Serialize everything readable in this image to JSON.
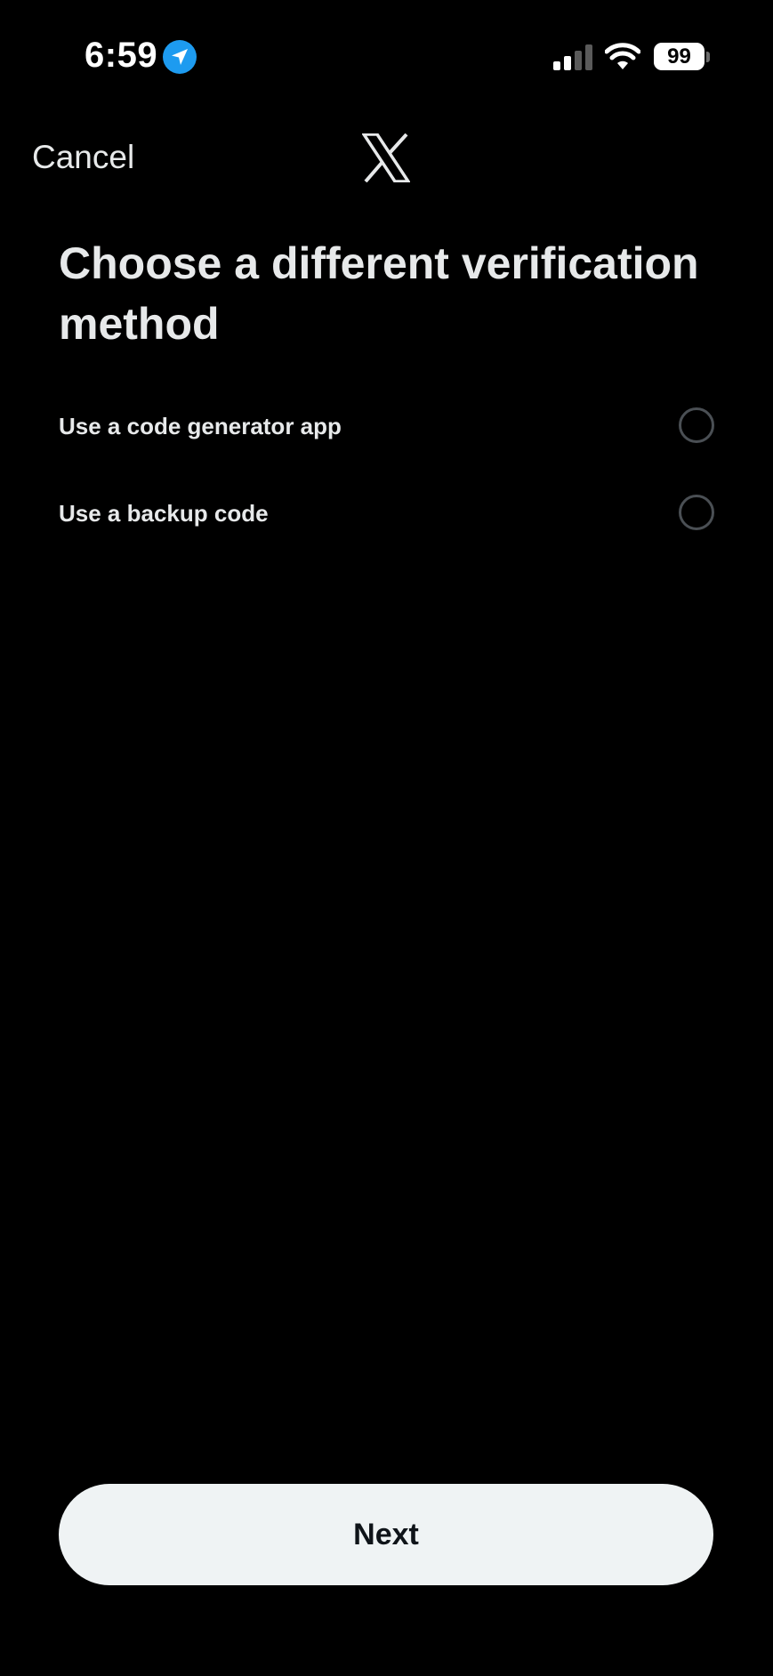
{
  "status_bar": {
    "time": "6:59",
    "battery": "99",
    "icons": [
      "location-arrow-icon",
      "cellular-signal-icon",
      "wifi-icon",
      "battery-icon"
    ]
  },
  "header": {
    "cancel_label": "Cancel",
    "logo": "x-logo-icon"
  },
  "main": {
    "title": "Choose a different verification method",
    "options": [
      {
        "label": "Use a code generator app",
        "selected": false
      },
      {
        "label": "Use a backup code",
        "selected": false
      }
    ]
  },
  "footer": {
    "next_label": "Next"
  },
  "colors": {
    "background": "#000000",
    "text": "#e7e9ea",
    "accent": "#1d9bf0",
    "button_bg": "#eff3f4",
    "radio_border": "#4a4f54"
  }
}
